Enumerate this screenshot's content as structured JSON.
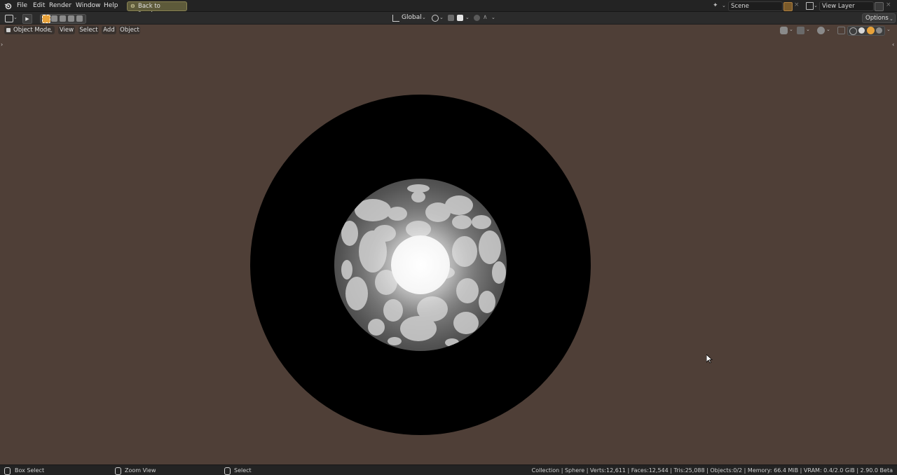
{
  "topbar": {
    "menus": [
      "File",
      "Edit",
      "Render",
      "Window",
      "Help"
    ],
    "back_button": "Back to Previous",
    "scene_name": "Scene",
    "view_layer_name": "View Layer"
  },
  "toolrow": {
    "orientation": "Global",
    "options_label": "Options"
  },
  "viewport_header": {
    "mode": "Object Mode",
    "menus": [
      "View",
      "Select",
      "Add",
      "Object"
    ]
  },
  "statusbar": {
    "left_hint": "Box Select",
    "middle_hint": "Zoom View",
    "right_hint": "Select",
    "stats": "Collection | Sphere | Verts:12,611 | Faces:12,544 | Tris:25,088 | Objects:0/2 | Memory: 66.4 MiB | VRAM: 0.4/2.0 GiB | 2.90.0 Beta"
  },
  "colors": {
    "viewport_bg": "#4f3f37",
    "accent": "#e8a23a",
    "topbar": "#232323"
  }
}
